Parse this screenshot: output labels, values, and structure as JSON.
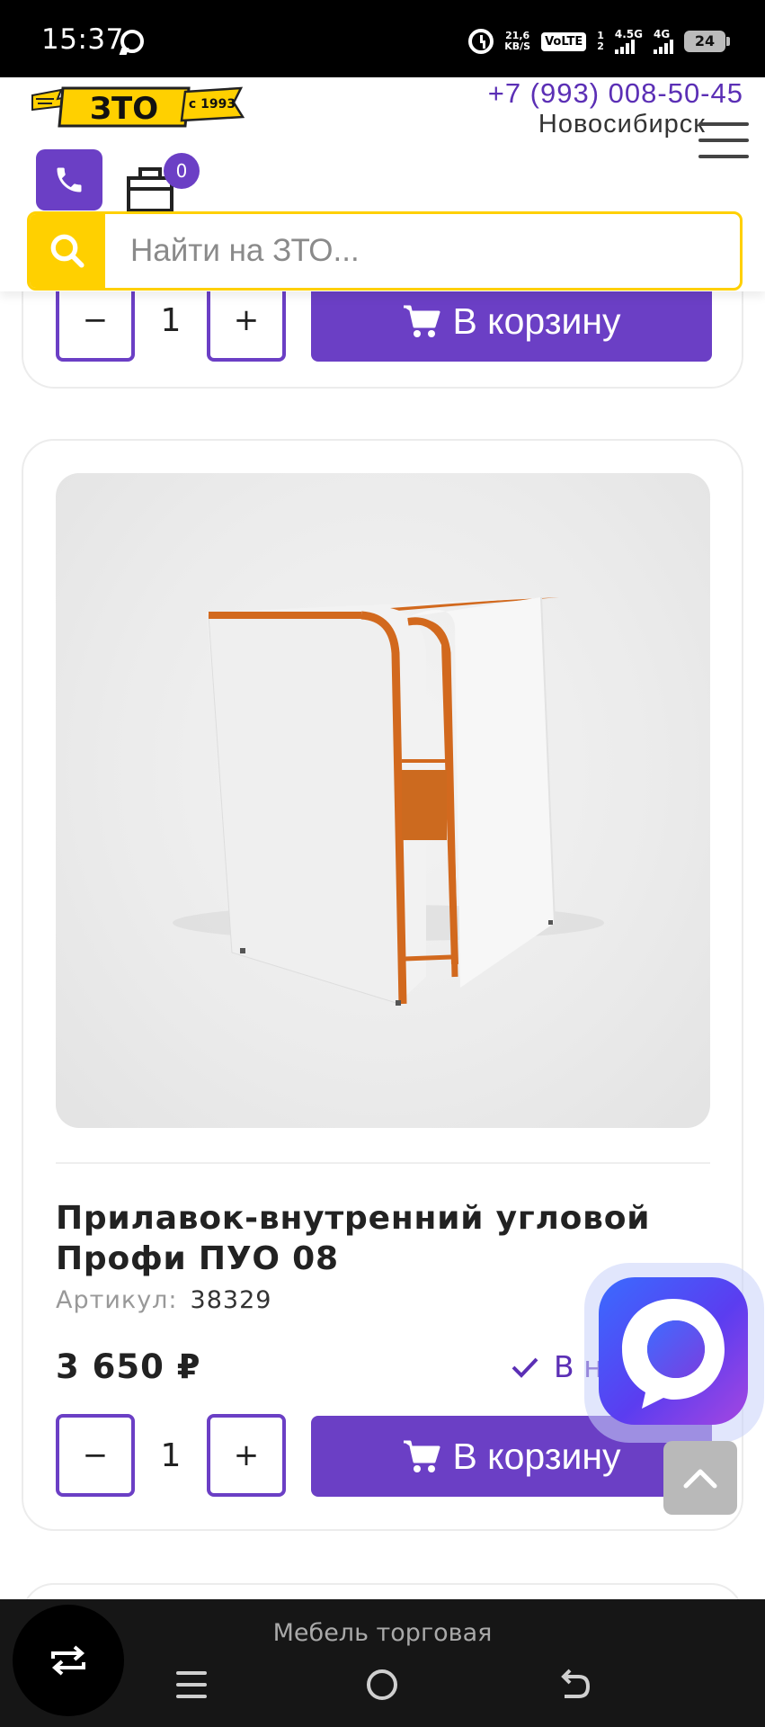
{
  "status_bar": {
    "time": "15:37",
    "net_speed_value": "21,6",
    "net_speed_unit": "KB/S",
    "volte": "VoLTE",
    "sim1_index": "1",
    "sim2_index": "2",
    "sim1_network": "4.5G",
    "sim2_network": "4G",
    "battery": "24"
  },
  "header": {
    "logo_text": "ЗТО",
    "logo_since": "с 1993",
    "phone": "+7 (993) 008-50-45",
    "city": "Новосибирск",
    "cart_count": "0",
    "search_placeholder": "Найти на ЗТО..."
  },
  "colors": {
    "accent": "#6b3fc5",
    "brand_yellow": "#ffd000"
  },
  "products": [
    {
      "quantity": "1",
      "decrement": "−",
      "increment": "+",
      "add_to_cart": "В корзину"
    },
    {
      "title": "Прилавок-внутренний угловой Профи ПУО 08",
      "sku_label": "Артикул:",
      "sku": "38329",
      "price": "3 650 ₽",
      "stock": "В н",
      "quantity": "1",
      "decrement": "−",
      "increment": "+",
      "add_to_cart": "В корзину"
    }
  ],
  "nav_bar": {
    "page_label": "Мебель торговая"
  }
}
